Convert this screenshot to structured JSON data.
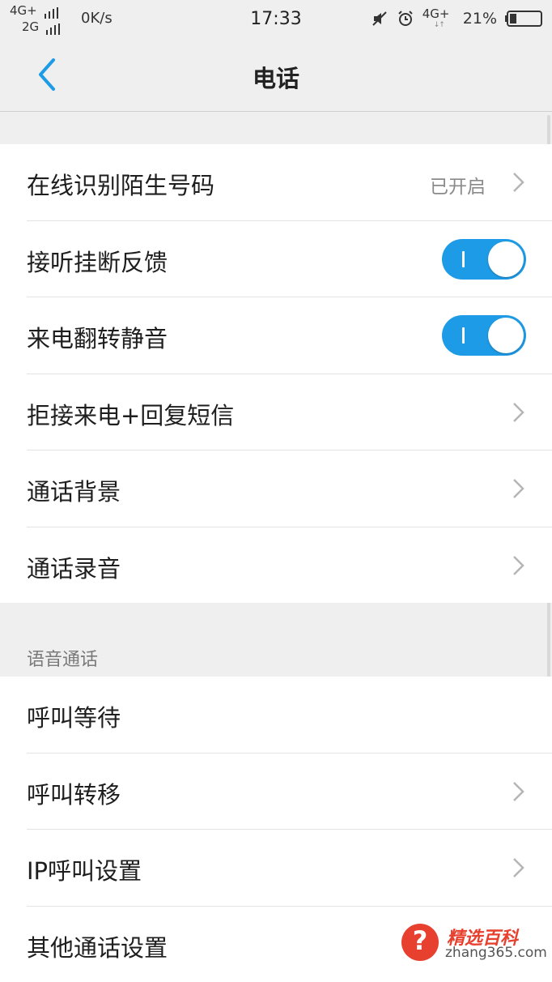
{
  "status_bar": {
    "net1": "4G+",
    "net2": "2G",
    "speed": "0K/s",
    "time": "17:33",
    "net_right": "4G+",
    "net_right_arrows": "↓↑",
    "battery": "21%"
  },
  "nav": {
    "title": "电话"
  },
  "group1": {
    "items": [
      {
        "label": "在线识别陌生号码",
        "value": "已开启"
      },
      {
        "label": "接听挂断反馈",
        "toggle": true
      },
      {
        "label": "来电翻转静音",
        "toggle": true
      },
      {
        "label": "拒接来电+回复短信"
      },
      {
        "label": "通话背景"
      },
      {
        "label": "通话录音"
      }
    ]
  },
  "section2": {
    "header": "语音通话",
    "items": [
      {
        "label": "呼叫等待"
      },
      {
        "label": "呼叫转移"
      },
      {
        "label": "IP呼叫设置"
      },
      {
        "label": "其他通话设置"
      }
    ]
  },
  "watermark": {
    "icon": "?",
    "title": "精选百科",
    "domain": "zhang365.com"
  },
  "colors": {
    "accent": "#1e9be6",
    "background": "#efefef",
    "watermark_red": "#e8402f"
  }
}
